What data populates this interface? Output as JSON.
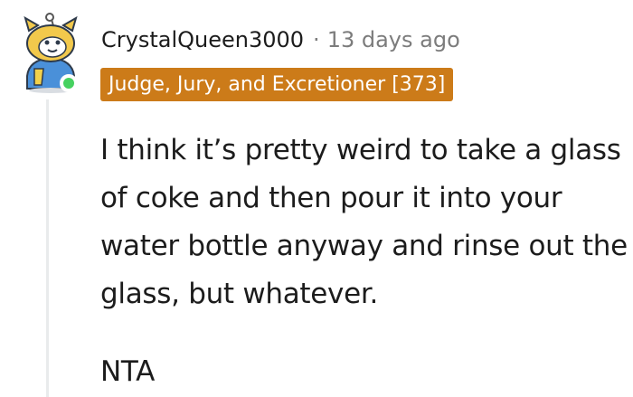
{
  "comment": {
    "username": "CrystalQueen3000",
    "separator": "·",
    "timestamp": "13 days ago",
    "flair": "Judge, Jury, and Excretioner [373]",
    "paragraphs": [
      "I think it’s pretty weird to take a glass of coke and then pour it into your water bottle anyway and rinse out the glass, but whatever.",
      "NTA"
    ],
    "avatar": {
      "icon": "snoo-avatar-icon",
      "online": true
    }
  },
  "colors": {
    "flair_bg": "#cc7b19",
    "online_dot": "#46d160",
    "meta_text": "#7c7c7c",
    "thread_line": "#e9ebec"
  }
}
